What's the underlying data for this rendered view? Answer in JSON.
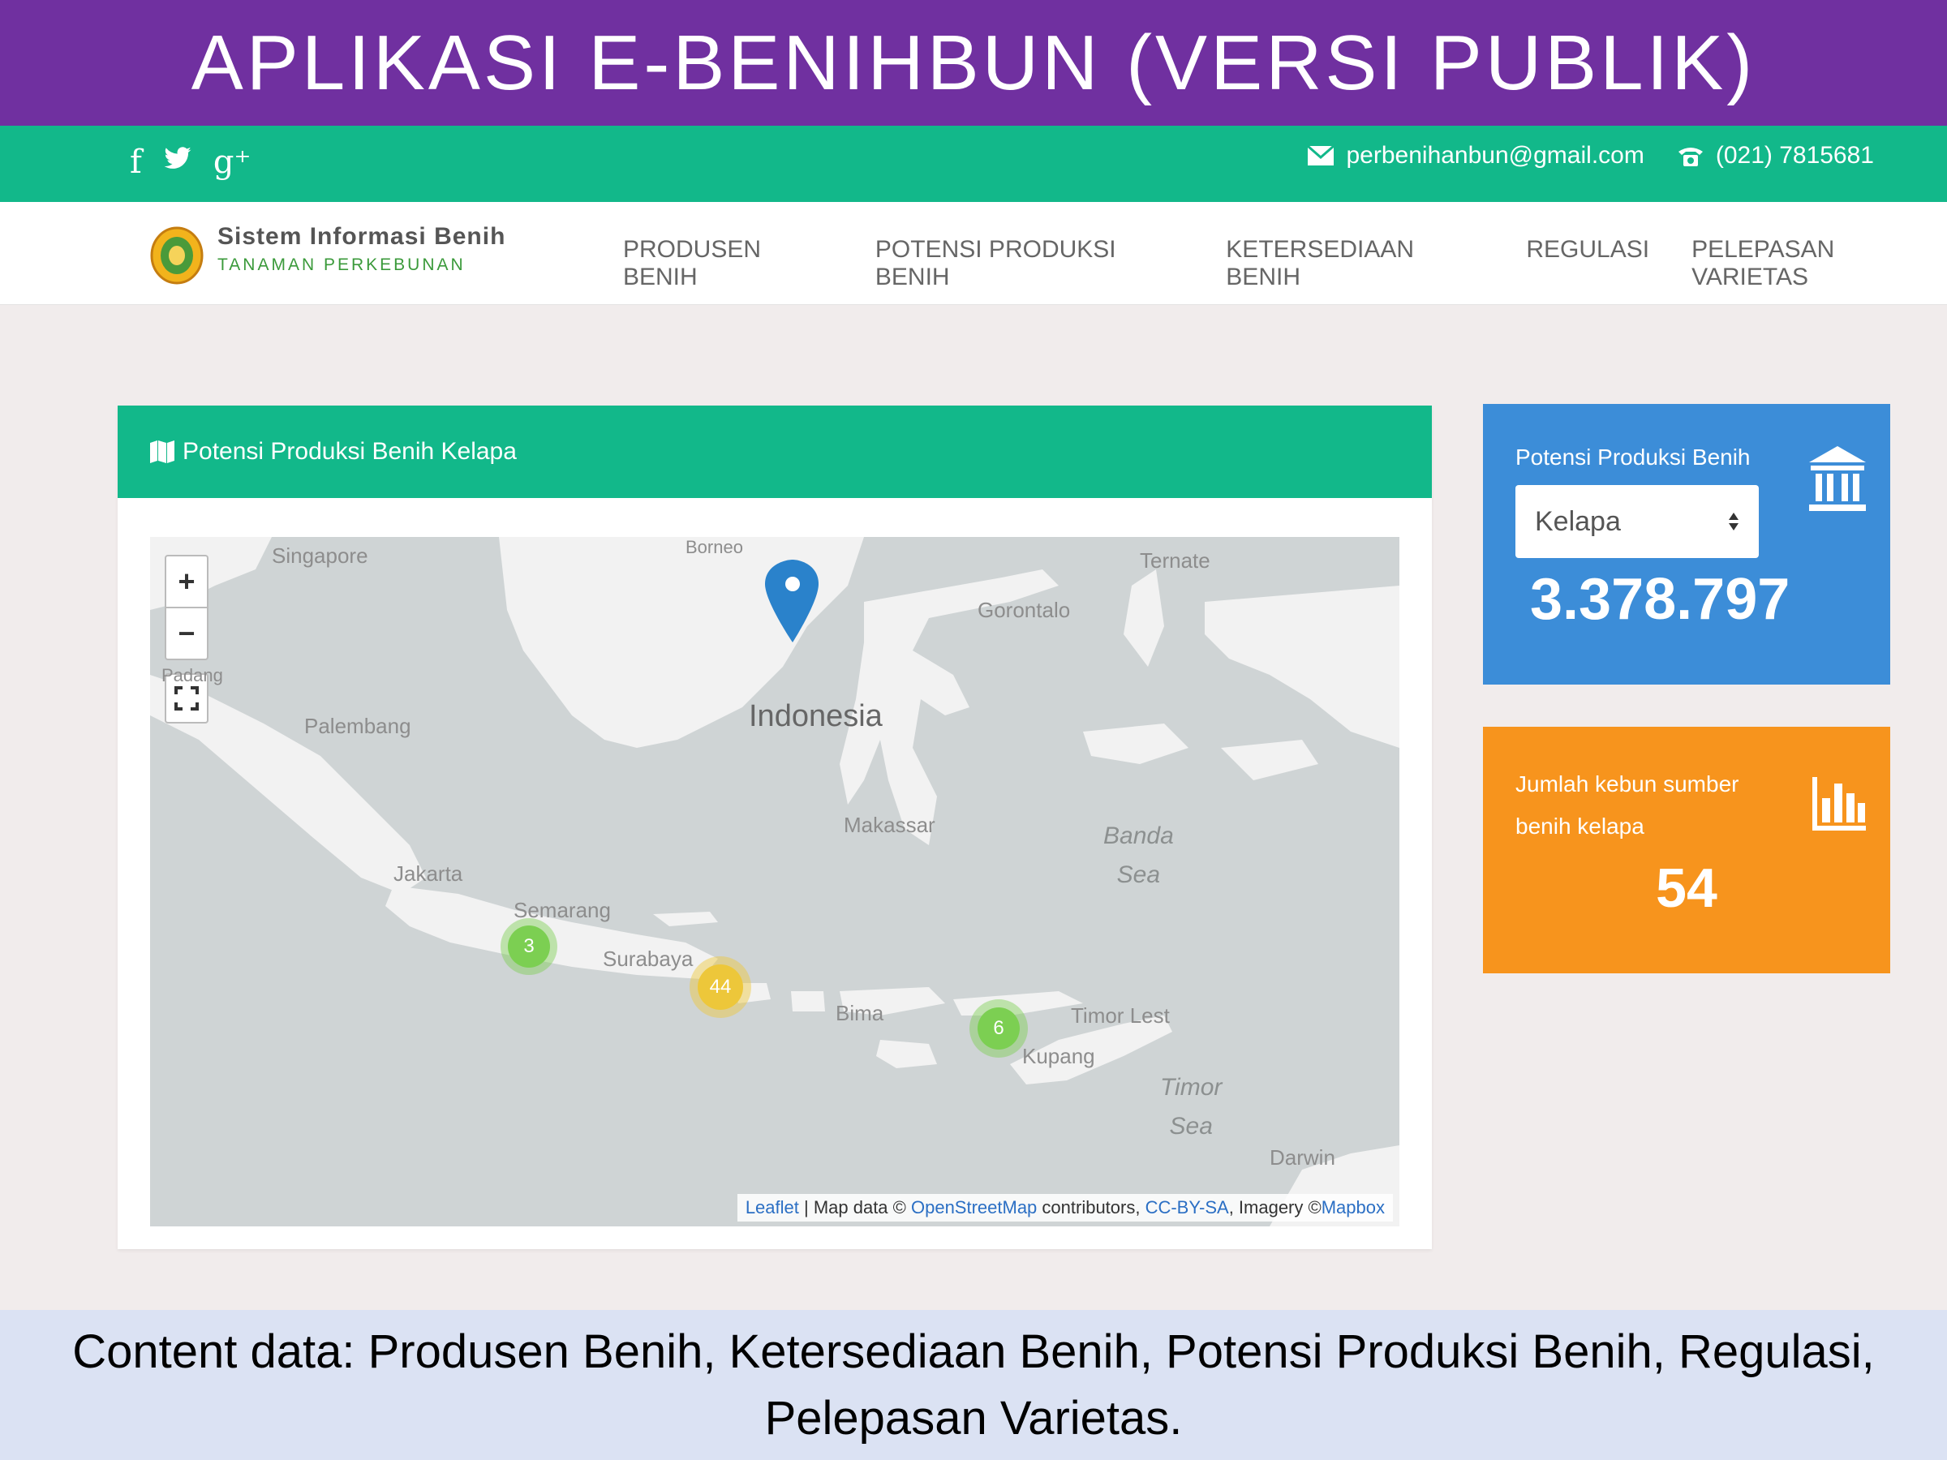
{
  "slide": {
    "title": "APLIKASI E-BENIHBUN (VERSI PUBLIK)",
    "footer": "Content data: Produsen Benih, Ketersediaan Benih, Potensi Produksi Benih, Regulasi, Pelepasan Varietas."
  },
  "topbar": {
    "social": [
      {
        "icon": "facebook-icon",
        "glyph": "f"
      },
      {
        "icon": "twitter-icon",
        "glyph": "🐦"
      },
      {
        "icon": "google-plus-icon",
        "glyph": "g⁺"
      }
    ],
    "email": "perbenihanbun@gmail.com",
    "phone": "(021) 7815681"
  },
  "navbar": {
    "brand_title": "Sistem Informasi Benih",
    "brand_subtitle": "TANAMAN PERKEBUNAN",
    "menu": [
      "PRODUSEN BENIH",
      "POTENSI PRODUKSI BENIH",
      "KETERSEDIAAN BENIH",
      "REGULASI",
      "PELEPASAN VARIETAS"
    ]
  },
  "map_panel": {
    "heading": "Potensi Produksi Benih Kelapa",
    "controls": {
      "zoom_in": "+",
      "zoom_out": "−"
    },
    "places": {
      "singapore": "Singapore",
      "borneo": "Borneo",
      "ternate": "Ternate",
      "gorontalo": "Gorontalo",
      "padang": "Padang",
      "palembang": "Palembang",
      "indonesia": "Indonesia",
      "makassar": "Makassar",
      "jakarta": "Jakarta",
      "semarang": "Semarang",
      "surabaya": "Surabaya",
      "bima": "Bima",
      "kupang": "Kupang",
      "timor_leste": "Timor Lest",
      "banda_sea": "Banda\nSea",
      "timor_sea": "Timor\nSea",
      "darwin": "Darwin"
    },
    "clusters": [
      {
        "count": "3",
        "color": "#7ccf52"
      },
      {
        "count": "44",
        "color": "#edc73a"
      },
      {
        "count": "6",
        "color": "#7ccf52"
      }
    ],
    "attribution": {
      "leaflet": "Leaflet",
      "sep": " | Map data © ",
      "osm": "OpenStreetMap",
      "contrib": " contributors, ",
      "cc": "CC-BY-SA",
      "imagery": ", Imagery ©",
      "mapbox": "Mapbox"
    }
  },
  "stat_potensi": {
    "label": "Potensi Produksi Benih",
    "select_value": "Kelapa",
    "value": "3.378.797",
    "icon": "bank-icon",
    "color": "#3c8dd8"
  },
  "stat_kebun": {
    "label": "Jumlah kebun sumber benih kelapa",
    "value": "54",
    "icon": "bar-chart-icon",
    "color": "#f7941d"
  }
}
